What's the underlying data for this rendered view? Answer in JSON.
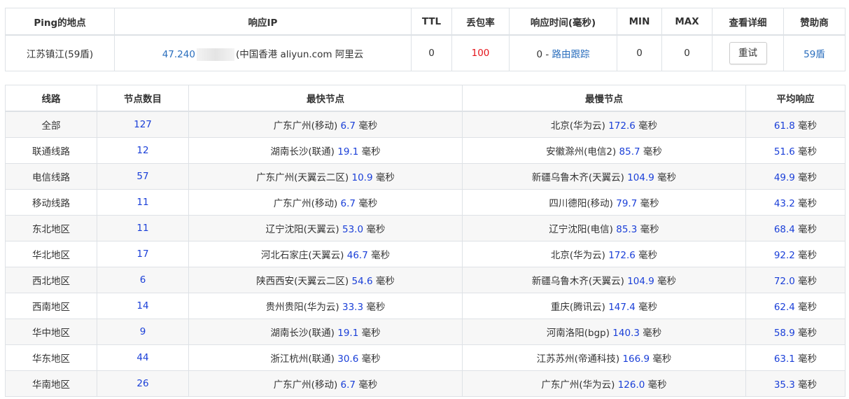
{
  "top": {
    "headers": [
      "Ping的地点",
      "响应IP",
      "TTL",
      "丢包率",
      "响应时间(毫秒)",
      "MIN",
      "MAX",
      "查看详细",
      "赞助商"
    ],
    "row": {
      "location": "江苏镇江(59盾)",
      "ip_prefix": "47.240",
      "ip_info": "(中国香港 aliyun.com 阿里云",
      "ttl": "0",
      "loss": "100",
      "resp_value": "0 -",
      "route_link": "路由跟踪",
      "min": "0",
      "max": "0",
      "retry": "重试",
      "sponsor": "59盾"
    },
    "colors": {
      "loss": "#e4141b",
      "link": "#2a6ebd"
    }
  },
  "stats": {
    "headers": [
      "线路",
      "节点数目",
      "最快节点",
      "最慢节点",
      "平均响应"
    ],
    "unit": "毫秒",
    "rows": [
      {
        "line": "全部",
        "count": "127",
        "fast_name": "广东广州(移动)",
        "fast_ms": "6.7",
        "slow_name": "北京(华为云)",
        "slow_ms": "172.6",
        "avg": "61.8"
      },
      {
        "line": "联通线路",
        "count": "12",
        "fast_name": "湖南长沙(联通)",
        "fast_ms": "19.1",
        "slow_name": "安徽滁州(电信2)",
        "slow_ms": "85.7",
        "avg": "51.6"
      },
      {
        "line": "电信线路",
        "count": "57",
        "fast_name": "广东广州(天翼云二区)",
        "fast_ms": "10.9",
        "slow_name": "新疆乌鲁木齐(天翼云)",
        "slow_ms": "104.9",
        "avg": "49.9"
      },
      {
        "line": "移动线路",
        "count": "11",
        "fast_name": "广东广州(移动)",
        "fast_ms": "6.7",
        "slow_name": "四川德阳(移动)",
        "slow_ms": "79.7",
        "avg": "43.2"
      },
      {
        "line": "东北地区",
        "count": "11",
        "fast_name": "辽宁沈阳(天翼云)",
        "fast_ms": "53.0",
        "slow_name": "辽宁沈阳(电信)",
        "slow_ms": "85.3",
        "avg": "68.4"
      },
      {
        "line": "华北地区",
        "count": "17",
        "fast_name": "河北石家庄(天翼云)",
        "fast_ms": "46.7",
        "slow_name": "北京(华为云)",
        "slow_ms": "172.6",
        "avg": "92.2"
      },
      {
        "line": "西北地区",
        "count": "6",
        "fast_name": "陕西西安(天翼云二区)",
        "fast_ms": "54.6",
        "slow_name": "新疆乌鲁木齐(天翼云)",
        "slow_ms": "104.9",
        "avg": "72.0"
      },
      {
        "line": "西南地区",
        "count": "14",
        "fast_name": "贵州贵阳(华为云)",
        "fast_ms": "33.3",
        "slow_name": "重庆(腾讯云)",
        "slow_ms": "147.4",
        "avg": "62.4"
      },
      {
        "line": "华中地区",
        "count": "9",
        "fast_name": "湖南长沙(联通)",
        "fast_ms": "19.1",
        "slow_name": "河南洛阳(bgp)",
        "slow_ms": "140.3",
        "avg": "58.9"
      },
      {
        "line": "华东地区",
        "count": "44",
        "fast_name": "浙江杭州(联通)",
        "fast_ms": "30.6",
        "slow_name": "江苏苏州(帝通科技)",
        "slow_ms": "166.9",
        "avg": "63.1"
      },
      {
        "line": "华南地区",
        "count": "26",
        "fast_name": "广东广州(移动)",
        "fast_ms": "6.7",
        "slow_name": "广东广州(华为云)",
        "slow_ms": "126.0",
        "avg": "35.3"
      }
    ],
    "colors": {
      "value": "#1a3fd8"
    }
  }
}
